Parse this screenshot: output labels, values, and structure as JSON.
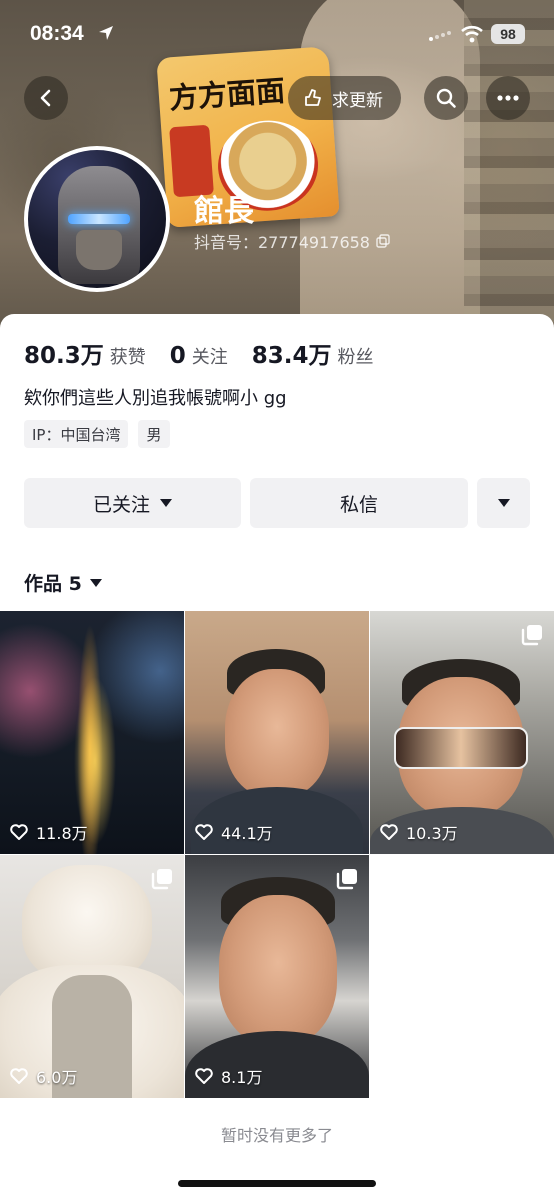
{
  "status_bar": {
    "time": "08:34",
    "battery": "98"
  },
  "header": {
    "update_label": "求更新"
  },
  "profile": {
    "name": "館長",
    "douyin_id": "抖音号：27774917658",
    "stats": [
      {
        "value": "80.3万",
        "label": "获赞"
      },
      {
        "value": "0",
        "label": "关注"
      },
      {
        "value": "83.4万",
        "label": "粉丝"
      }
    ],
    "bio": "欸你們這些人別追我帳號啊小 gg",
    "tags": [
      "IP：中国台湾",
      "男"
    ]
  },
  "actions": {
    "follow": "已关注",
    "message": "私信"
  },
  "works": {
    "label": "作品 5"
  },
  "videos": [
    {
      "likes": "11.8万",
      "multi_image": false
    },
    {
      "likes": "44.1万",
      "multi_image": false
    },
    {
      "likes": "10.3万",
      "multi_image": true
    },
    {
      "likes": "6.0万",
      "multi_image": true
    },
    {
      "likes": "8.1万",
      "multi_image": true
    }
  ],
  "footer": {
    "text": "暂时没有更多了"
  }
}
